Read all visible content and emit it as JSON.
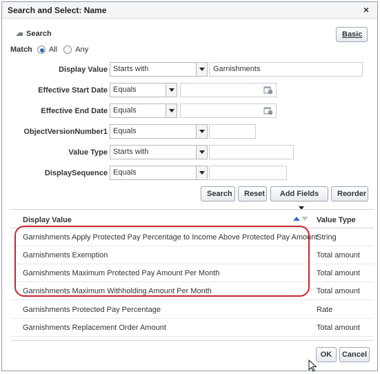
{
  "dialog": {
    "title": "Search and Select: Name",
    "close_glyph": "×"
  },
  "search": {
    "section_title": "Search",
    "basic_button": "Basic",
    "match_label": "Match",
    "match_all": "All",
    "match_any": "Any",
    "match_selected": "All",
    "fields": [
      {
        "label": "Display Value",
        "operator": "Starts with",
        "value": "Garnishments"
      },
      {
        "label": "Effective Start Date",
        "operator": "Equals",
        "value": ""
      },
      {
        "label": "Effective End Date",
        "operator": "Equals",
        "value": ""
      },
      {
        "label": "ObjectVersionNumber1",
        "operator": "Equals",
        "value": ""
      },
      {
        "label": "Value Type",
        "operator": "Starts with",
        "value": ""
      },
      {
        "label": "DisplaySequence",
        "operator": "Equals",
        "value": ""
      }
    ],
    "buttons": {
      "search": "Search",
      "reset": "Reset",
      "add_fields": "Add Fields",
      "reorder": "Reorder"
    }
  },
  "results": {
    "columns": [
      "Display Value",
      "Value Type"
    ],
    "rows": [
      [
        "Garnishments Apply Protected Pay Percentage to Income Above Protected Pay Amount",
        "String"
      ],
      [
        "Garnishments Exemption",
        "Total amount"
      ],
      [
        "Garnishments Maximum Protected Pay Amount Per Month",
        "Total amount"
      ],
      [
        "Garnishments Maximum Withholding Amount Per Month",
        "Total amount"
      ],
      [
        "Garnishments Protected Pay Percentage",
        "Rate"
      ],
      [
        "Garnishments Replacement Order Amount",
        "Total amount"
      ]
    ],
    "sort": {
      "column": "Display Value",
      "direction": "ascending"
    }
  },
  "footer": {
    "ok": "OK",
    "cancel": "Cancel"
  },
  "colors": {
    "highlight": "#c9222c",
    "sort_active": "#2f73c4",
    "title_bar": "#f3f5f7"
  },
  "icons": [
    "close-icon",
    "disclosure-triangle-icon",
    "dropdown-arrow-icon",
    "calendar-icon",
    "sort-ascending-icon",
    "sort-descending-icon",
    "mouse-cursor-icon"
  ]
}
